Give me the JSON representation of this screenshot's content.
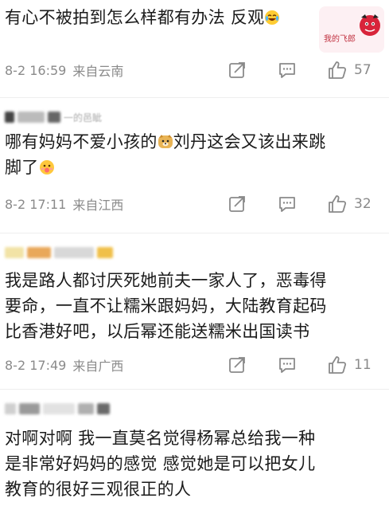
{
  "comments": [
    {
      "text_lines": [
        "有心不被拍到怎么样都有办法 反观"
      ],
      "emoji": "crying-laughing-emoji",
      "sticker_text": "我的飞郎",
      "date": "8-2 16:59",
      "location": "来自云南",
      "likes": "57"
    },
    {
      "username_fragment": "一的邑眦",
      "text_lines": [
        "哪有妈妈不爱小孩的",
        "刘丹这会又该出来跳",
        "脚了"
      ],
      "emoji_inline": "doge-emoji",
      "emoji_end": "hungry-emoji",
      "date": "8-2 17:11",
      "location": "来自江西",
      "likes": "32"
    },
    {
      "text_lines": [
        "我是路人都讨厌死她前夫一家人了，恶毒得",
        "要命，一直不让糯米跟妈妈，大陆教育起码",
        "比香港好吧，以后幂还能送糯米出国读书"
      ],
      "date": "8-2 17:49",
      "location": "来自广西",
      "likes": "11"
    },
    {
      "text_lines": [
        "对啊对啊 我一直莫名觉得杨幂总给我一种",
        "是非常好妈妈的感觉 感觉她是可以把女儿",
        "教育的很好三观很正的人"
      ]
    }
  ],
  "colors": {
    "text": "#1b1b1b",
    "meta": "#8a8a8a"
  }
}
